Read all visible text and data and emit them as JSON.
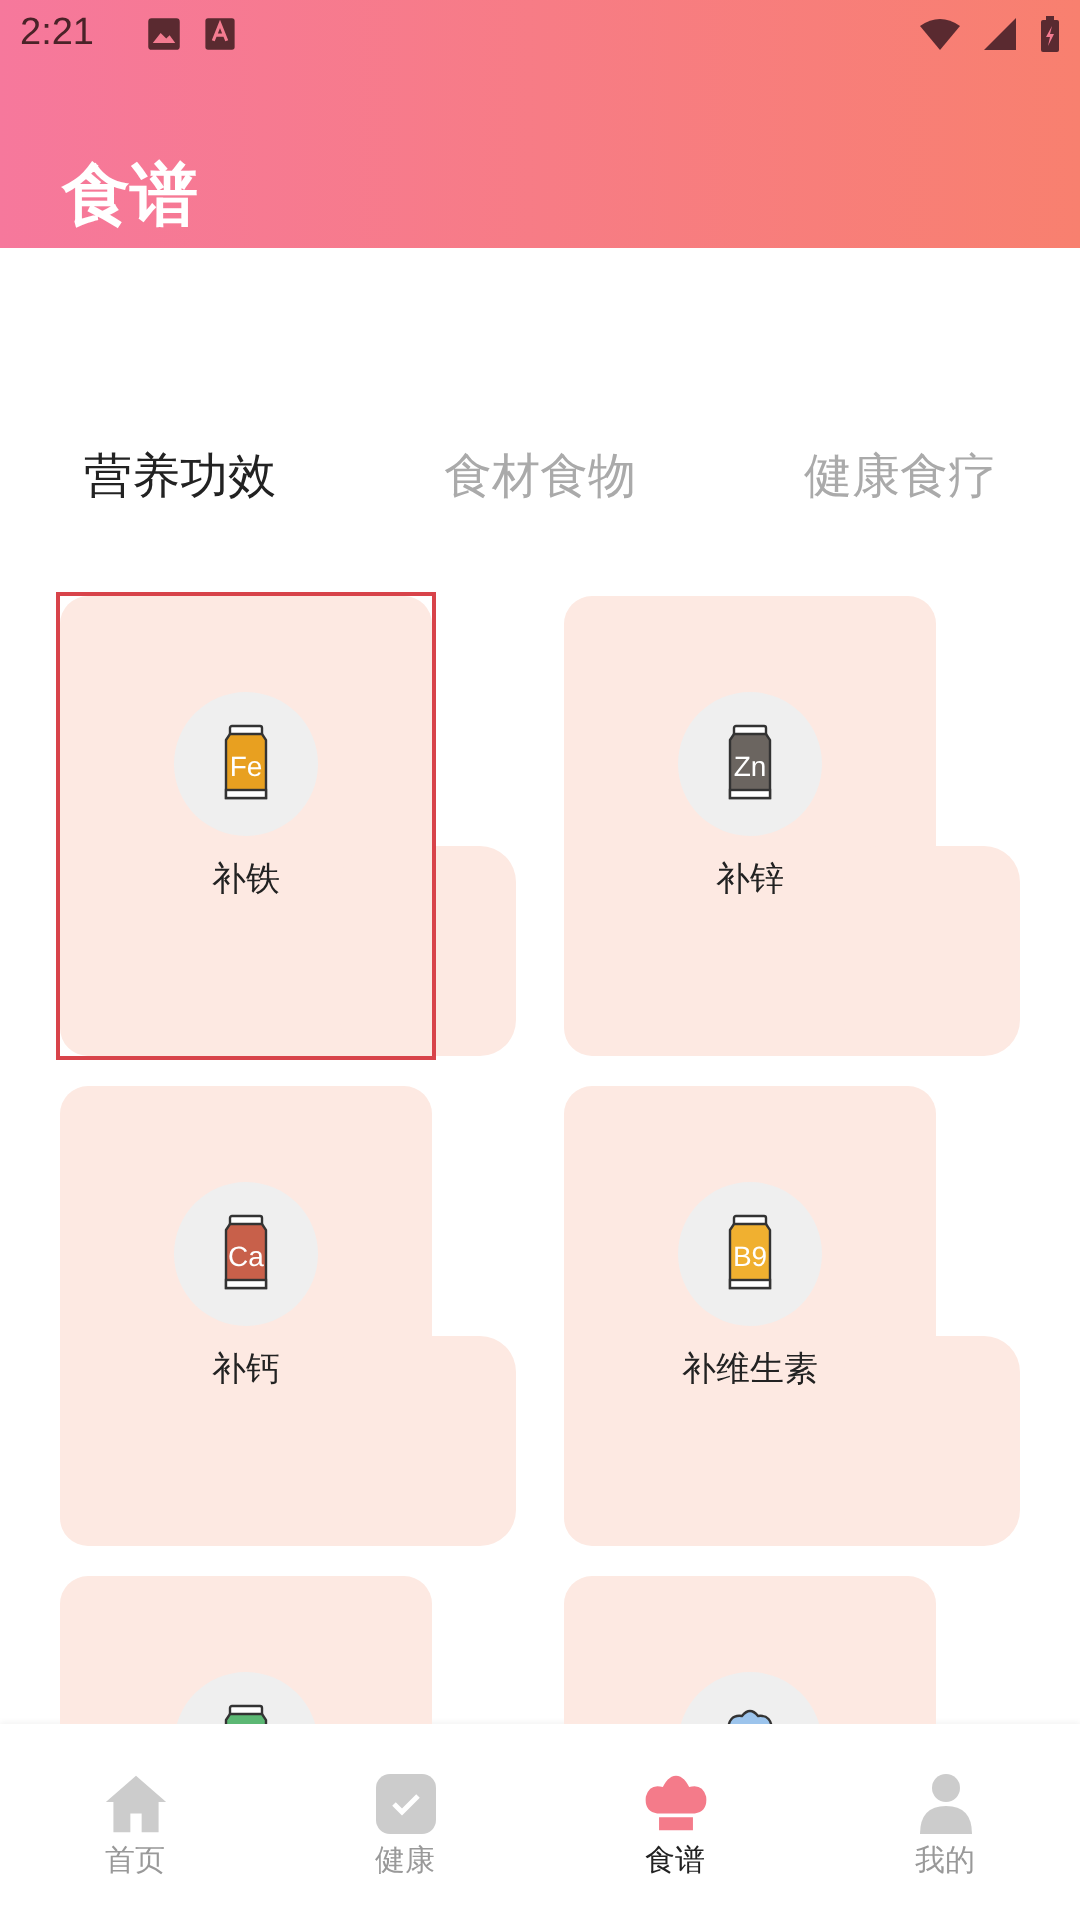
{
  "status_bar": {
    "time": "2:21"
  },
  "header": {
    "title": "食谱"
  },
  "tabs": [
    {
      "label": "营养功效",
      "selected": true
    },
    {
      "label": "食材食物",
      "selected": false
    },
    {
      "label": "健康食疗",
      "selected": false
    }
  ],
  "items": [
    {
      "kind": "jar",
      "symbol": "Fe",
      "color": "#e8a020",
      "label": "补铁",
      "selected": true
    },
    {
      "kind": "jar",
      "symbol": "Zn",
      "color": "#6b6560",
      "label": "补锌",
      "selected": false
    },
    {
      "kind": "jar",
      "symbol": "Ca",
      "color": "#c8604a",
      "label": "补钙",
      "selected": false
    },
    {
      "kind": "jar",
      "symbol": "B9",
      "color": "#f0b030",
      "label": "补维生素",
      "selected": false
    },
    {
      "kind": "jar",
      "color": "#5cb874",
      "selected": false
    },
    {
      "kind": "cloud",
      "color": "#9cc4ec",
      "selected": false
    }
  ],
  "bottom_nav": [
    {
      "kind": "home",
      "label": "首页",
      "selected": false
    },
    {
      "kind": "health",
      "label": "健康",
      "selected": false
    },
    {
      "kind": "recipe",
      "label": "食谱",
      "selected": true
    },
    {
      "kind": "profile",
      "label": "我的",
      "selected": false
    }
  ]
}
